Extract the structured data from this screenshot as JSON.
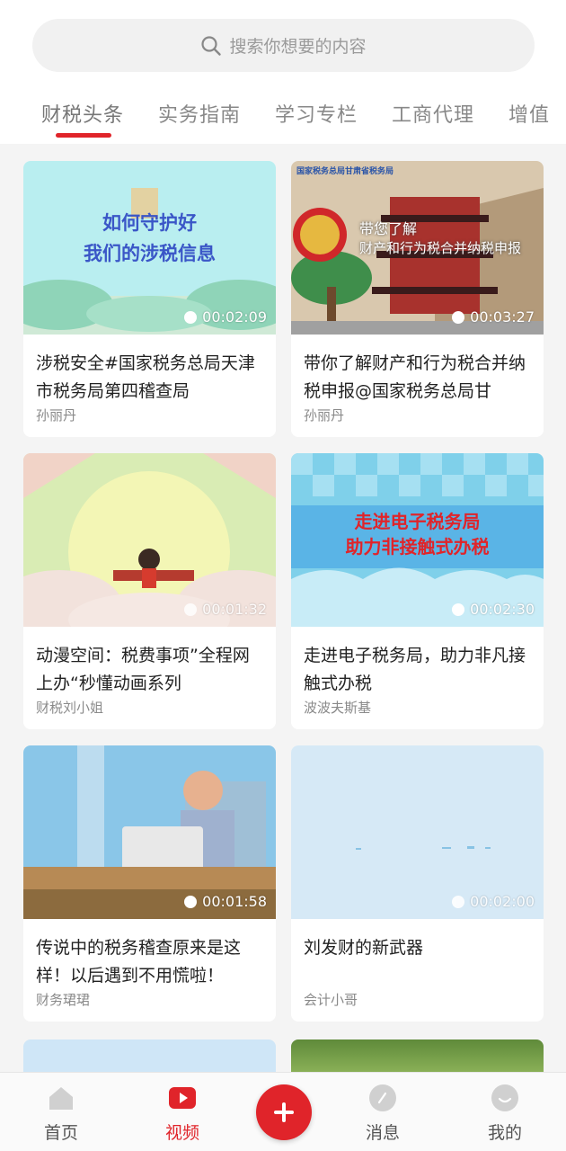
{
  "search": {
    "placeholder": "搜索你想要的内容"
  },
  "tabs": [
    "财税头条",
    "实务指南",
    "学习专栏",
    "工商代理",
    "增值"
  ],
  "videos": [
    {
      "title": "涉税安全#国家税务总局天津市税务局第四稽查局",
      "author": "孙丽丹",
      "duration": "00:02:09",
      "overlay": [
        "如何守护好",
        "我们的涉税信息"
      ]
    },
    {
      "title": "带你了解财产和行为税合并纳税申报@国家税务总局甘",
      "author": "孙丽丹",
      "duration": "00:03:27",
      "overlay": [
        "国家税务总局甘肃省税务局",
        "带您了解",
        "财产和行为税合并纳税申报"
      ]
    },
    {
      "title": "动漫空间：税费事项”全程网上办“秒懂动画系列",
      "author": "财税刘小姐",
      "duration": "00:01:32",
      "overlay": []
    },
    {
      "title": "走进电子税务局，助力非凡接触式办税",
      "author": "波波夫斯基",
      "duration": "00:02:30",
      "overlay": [
        "走进电子税务局",
        "助力非接触式办税"
      ]
    },
    {
      "title": "传说中的税务稽查原来是这样！以后遇到不用慌啦！",
      "author": "财务珺珺",
      "duration": "00:01:58",
      "overlay": []
    },
    {
      "title": "刘发财的新武器",
      "author": "会计小哥",
      "duration": "00:02:00",
      "overlay": []
    }
  ],
  "bottom_nav": [
    {
      "label": "首页",
      "icon": "home-icon"
    },
    {
      "label": "视频",
      "icon": "video-icon",
      "active": true
    },
    {
      "label": "",
      "icon": "plus-icon"
    },
    {
      "label": "消息",
      "icon": "message-icon"
    },
    {
      "label": "我的",
      "icon": "profile-icon"
    }
  ],
  "colors": {
    "accent": "#e0242a",
    "background": "#f4f4f4"
  }
}
